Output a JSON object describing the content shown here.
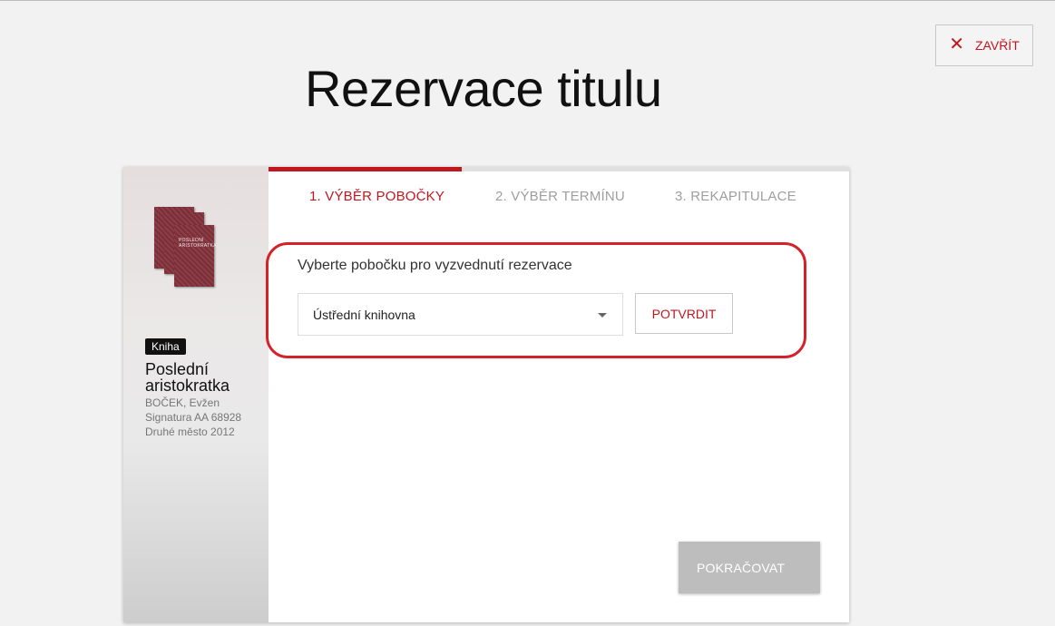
{
  "header": {
    "close_label": "ZAVŘÍT",
    "close_icon": "close-icon",
    "title": "Rezervace titulu"
  },
  "book": {
    "cover_text": "POSLEDNÍ ARISTOKRATKA",
    "badge": "Kniha",
    "title": "Poslední aristokratka",
    "author": "BOČEK, Evžen",
    "signature": "Signatura AA 68928",
    "edition": "Druhé město 2012"
  },
  "steps": {
    "progress_fraction": 0.333,
    "active_index": 0,
    "tabs": [
      {
        "label": "1. VÝBĚR POBOČKY"
      },
      {
        "label": "2. VÝBĚR TERMÍNU"
      },
      {
        "label": "3. REKAPITULACE"
      }
    ]
  },
  "form": {
    "prompt": "Vyberte pobočku pro vyzvednutí rezervace",
    "selected_branch": "Ústřední knihovna",
    "confirm_label": "POTVRDIT"
  },
  "footer": {
    "continue_label": "POKRAČOVAT"
  },
  "colors": {
    "accent": "#c0161e",
    "highlight": "#d3222a",
    "disabled_button": "#bdbdbd",
    "background": "#f2f2f2"
  }
}
